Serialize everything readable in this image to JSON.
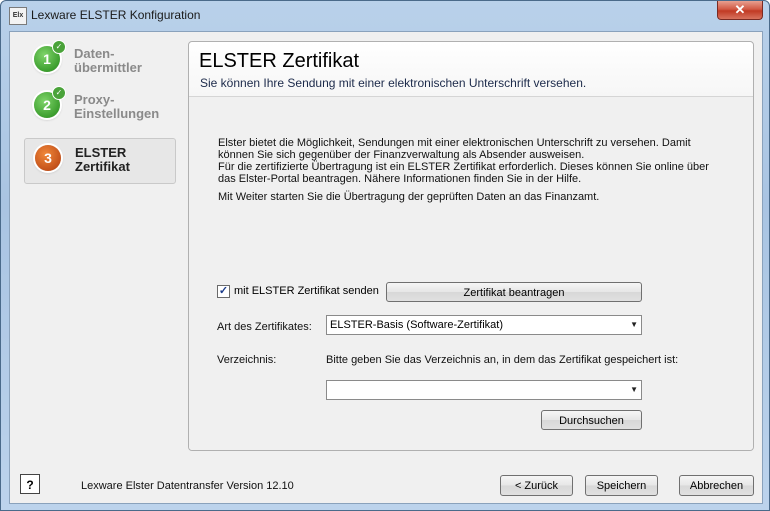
{
  "window": {
    "title": "Lexware ELSTER Konfiguration",
    "icon_text": "Elx",
    "close_glyph": "✕"
  },
  "steps": [
    {
      "number": "1",
      "label_line1": "Daten-",
      "label_line2": "übermittler",
      "done": true
    },
    {
      "number": "2",
      "label_line1": "Proxy-",
      "label_line2": "Einstellungen",
      "done": true
    },
    {
      "number": "3",
      "label_line1": "ELSTER",
      "label_line2": "Zertifikat",
      "done": false
    }
  ],
  "check_glyph": "✓",
  "panel": {
    "title": "ELSTER Zertifikat",
    "subtitle": "Sie können Ihre Sendung mit einer elektronischen Unterschrift versehen.",
    "desc1_line1": "Elster bietet die Möglichkeit, Sendungen mit einer elektronischen Unterschrift zu versehen. Damit",
    "desc1_line2": "können Sie sich gegenüber der Finanzverwaltung als Absender ausweisen.",
    "desc1_line3": "Für die zertifizierte Übertragung ist ein ELSTER Zertifikat erforderlich. Dieses können Sie online über",
    "desc1_line4": "das Elster-Portal beantragen. Nähere Informationen finden Sie in der Hilfe.",
    "desc2": "Mit Weiter starten Sie die Übertragung der geprüften Daten an das Finanzamt."
  },
  "form": {
    "checkbox_label": "mit ELSTER Zertifikat senden",
    "checkbox_checked_glyph": "✓",
    "request_button": "Zertifikat beantragen",
    "cert_type_label": "Art des Zertifikates:",
    "cert_type_value": "ELSTER-Basis (Software-Zertifikat)",
    "dir_label": "Verzeichnis:",
    "dir_hint": "Bitte geben Sie das Verzeichnis an, in dem das Zertifikat gespeichert ist:",
    "dir_value": "",
    "dropdown_glyph": "▼",
    "browse_button": "Durchsuchen"
  },
  "footer": {
    "help_glyph": "?",
    "version": "Lexware Elster Datentransfer Version 12.10",
    "back_button": "< Zurück",
    "save_button": "Speichern",
    "cancel_button": "Abbrechen"
  }
}
